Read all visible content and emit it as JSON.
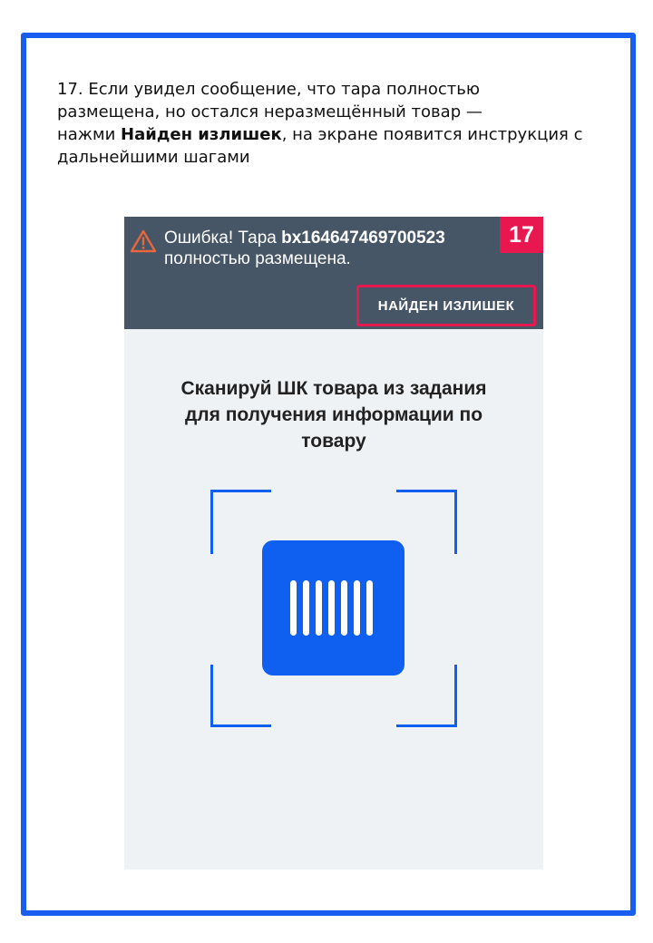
{
  "instruction": {
    "line1": "17. Если увидел сообщение, что тара полностью",
    "line2": "размещена, но остался неразмещённый товар —",
    "line3_prefix": "нажми ",
    "line3_bold": "Найден излишек",
    "line3_suffix": ", на экране появится инструкция с",
    "line4": "дальнейшими шагами"
  },
  "screen": {
    "error": {
      "prefix": "Ошибка! Тара ",
      "code": "bx164647469700523",
      "line2": "полностью размещена.",
      "icon": "warning-icon"
    },
    "step_badge": "17",
    "found_button_label": "НАЙДЕН ИЗЛИШЕК",
    "scan": {
      "line1": "Сканируй ШК товара из задания",
      "line2": "для получения информации по",
      "line3": "товару",
      "icon": "barcode-scan-icon"
    }
  },
  "colors": {
    "frame_border": "#1a5ef0",
    "topbar": "#465667",
    "accent_red": "#e8174f",
    "scan_blue": "#0f5ff0",
    "screen_background": "#eef2f5"
  }
}
